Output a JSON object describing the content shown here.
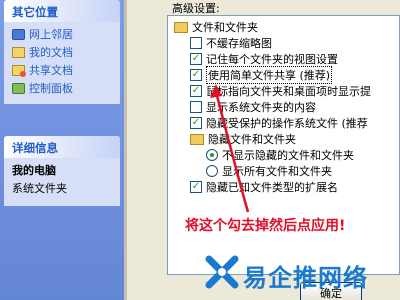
{
  "taskpane": {
    "other_places": {
      "title": "其它位置",
      "items": [
        {
          "label": "网上邻居",
          "icon": "network-icon"
        },
        {
          "label": "我的文档",
          "icon": "my-documents-icon"
        },
        {
          "label": "共享文档",
          "icon": "shared-documents-icon"
        },
        {
          "label": "控制面板",
          "icon": "control-panel-icon"
        }
      ]
    },
    "details": {
      "title": "详细信息",
      "name": "我的电脑",
      "type": "系统文件夹"
    }
  },
  "dialog": {
    "group_label": "高级设置:",
    "rows": [
      {
        "kind": "folder",
        "text": "文件和文件夹"
      },
      {
        "kind": "checkbox",
        "checked": false,
        "text": "不缓存缩略图"
      },
      {
        "kind": "checkbox",
        "checked": true,
        "text": "记住每个文件夹的视图设置"
      },
      {
        "kind": "checkbox",
        "checked": true,
        "text": "使用简单文件共享 (推荐)",
        "selected": true
      },
      {
        "kind": "checkbox",
        "checked": true,
        "text": "鼠标指向文件夹和桌面项时显示提"
      },
      {
        "kind": "checkbox",
        "checked": false,
        "text": "显示系统文件夹的内容"
      },
      {
        "kind": "checkbox",
        "checked": true,
        "text": "隐藏受保护的操作系统文件 (推荐"
      },
      {
        "kind": "folder",
        "text": "隐藏文件和文件夹"
      },
      {
        "kind": "radio",
        "checked": true,
        "text": "不显示隐藏的文件和文件夹"
      },
      {
        "kind": "radio",
        "checked": false,
        "text": "显示所有文件和文件夹"
      },
      {
        "kind": "checkbox",
        "checked": true,
        "text": "隐藏已知文件类型的扩展名"
      }
    ],
    "ok_label": "确定"
  },
  "annotation": {
    "text": "将这个勾去掉然后点应用!",
    "color": "#e0102a"
  },
  "watermark": {
    "text": "易企推网络",
    "color": "#1a7ad1"
  }
}
